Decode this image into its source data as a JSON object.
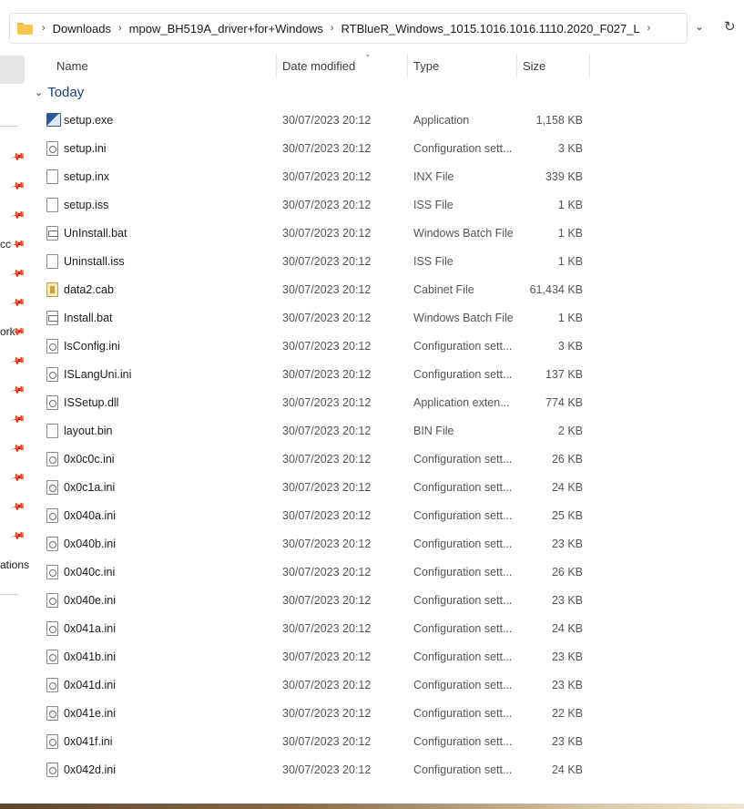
{
  "breadcrumb": [
    "Downloads",
    "mpow_BH519A_driver+for+Windows",
    "RTBlueR_Windows_1015.1016.1016.1110.2020_F027_L"
  ],
  "columns": {
    "name": "Name",
    "date": "Date modified",
    "type": "Type",
    "size": "Size"
  },
  "group_label": "Today",
  "nav_fragments": [
    "cc",
    "ork",
    "ations"
  ],
  "files": [
    {
      "name": "setup.exe",
      "date": "30/07/2023 20:12",
      "type": "Application",
      "size": "1,158 KB",
      "icon": "exe"
    },
    {
      "name": "setup.ini",
      "date": "30/07/2023 20:12",
      "type": "Configuration sett...",
      "size": "3 KB",
      "icon": "cfg"
    },
    {
      "name": "setup.inx",
      "date": "30/07/2023 20:12",
      "type": "INX File",
      "size": "339 KB",
      "icon": "doc"
    },
    {
      "name": "setup.iss",
      "date": "30/07/2023 20:12",
      "type": "ISS File",
      "size": "1 KB",
      "icon": "doc"
    },
    {
      "name": "UnInstall.bat",
      "date": "30/07/2023 20:12",
      "type": "Windows Batch File",
      "size": "1 KB",
      "icon": "bat"
    },
    {
      "name": "Uninstall.iss",
      "date": "30/07/2023 20:12",
      "type": "ISS File",
      "size": "1 KB",
      "icon": "doc"
    },
    {
      "name": "data2.cab",
      "date": "30/07/2023 20:12",
      "type": "Cabinet File",
      "size": "61,434 KB",
      "icon": "cab"
    },
    {
      "name": "Install.bat",
      "date": "30/07/2023 20:12",
      "type": "Windows Batch File",
      "size": "1 KB",
      "icon": "bat"
    },
    {
      "name": "IsConfig.ini",
      "date": "30/07/2023 20:12",
      "type": "Configuration sett...",
      "size": "3 KB",
      "icon": "cfg"
    },
    {
      "name": "ISLangUni.ini",
      "date": "30/07/2023 20:12",
      "type": "Configuration sett...",
      "size": "137 KB",
      "icon": "cfg"
    },
    {
      "name": "ISSetup.dll",
      "date": "30/07/2023 20:12",
      "type": "Application exten...",
      "size": "774 KB",
      "icon": "cfg"
    },
    {
      "name": "layout.bin",
      "date": "30/07/2023 20:12",
      "type": "BIN File",
      "size": "2 KB",
      "icon": "doc"
    },
    {
      "name": "0x0c0c.ini",
      "date": "30/07/2023 20:12",
      "type": "Configuration sett...",
      "size": "26 KB",
      "icon": "cfg"
    },
    {
      "name": "0x0c1a.ini",
      "date": "30/07/2023 20:12",
      "type": "Configuration sett...",
      "size": "24 KB",
      "icon": "cfg"
    },
    {
      "name": "0x040a.ini",
      "date": "30/07/2023 20:12",
      "type": "Configuration sett...",
      "size": "25 KB",
      "icon": "cfg"
    },
    {
      "name": "0x040b.ini",
      "date": "30/07/2023 20:12",
      "type": "Configuration sett...",
      "size": "23 KB",
      "icon": "cfg"
    },
    {
      "name": "0x040c.ini",
      "date": "30/07/2023 20:12",
      "type": "Configuration sett...",
      "size": "26 KB",
      "icon": "cfg"
    },
    {
      "name": "0x040e.ini",
      "date": "30/07/2023 20:12",
      "type": "Configuration sett...",
      "size": "23 KB",
      "icon": "cfg"
    },
    {
      "name": "0x041a.ini",
      "date": "30/07/2023 20:12",
      "type": "Configuration sett...",
      "size": "24 KB",
      "icon": "cfg"
    },
    {
      "name": "0x041b.ini",
      "date": "30/07/2023 20:12",
      "type": "Configuration sett...",
      "size": "23 KB",
      "icon": "cfg"
    },
    {
      "name": "0x041d.ini",
      "date": "30/07/2023 20:12",
      "type": "Configuration sett...",
      "size": "23 KB",
      "icon": "cfg"
    },
    {
      "name": "0x041e.ini",
      "date": "30/07/2023 20:12",
      "type": "Configuration sett...",
      "size": "22 KB",
      "icon": "cfg"
    },
    {
      "name": "0x041f.ini",
      "date": "30/07/2023 20:12",
      "type": "Configuration sett...",
      "size": "23 KB",
      "icon": "cfg"
    },
    {
      "name": "0x042d.ini",
      "date": "30/07/2023 20:12",
      "type": "Configuration sett...",
      "size": "24 KB",
      "icon": "cfg"
    }
  ]
}
